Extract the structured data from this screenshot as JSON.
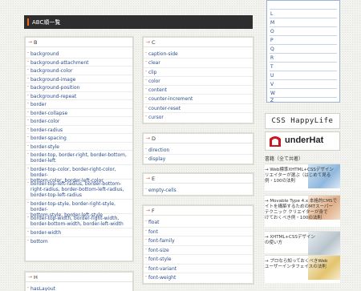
{
  "section_title": "ABC順一覧",
  "panels": {
    "B": {
      "letter": "B",
      "items": [
        "background",
        "background-attachment",
        "background-color",
        "background-image",
        "background-position",
        "background-repeat",
        "border",
        "border-collapse",
        "border-color",
        "border-radius",
        "border-spacing",
        "border-style",
        "border-top, border-right, border-bottom,",
        "border-left",
        "border-top-color, border-right-color, border-",
        "bottom-color, border-left-color",
        "border-top-left-radius, border-bottom-",
        "right-radius, border-bottom-left-radius,",
        "border-top-left-radius",
        "border-top-style, border-right-style, border-",
        "bottom-style, border-left-style",
        "border-top-width, border-right-width,",
        "border-bottom-width, border-left-width",
        "border-width",
        "bottom"
      ]
    },
    "C": {
      "letter": "C",
      "items": [
        "caption-side",
        "clear",
        "clip",
        "color",
        "content",
        "counter-increment",
        "counter-reset",
        "cursor"
      ]
    },
    "D": {
      "letter": "D",
      "items": [
        "direction",
        "display"
      ]
    },
    "E": {
      "letter": "E",
      "items": [
        "empty-cells"
      ]
    },
    "F": {
      "letter": "F",
      "items": [
        "float",
        "font",
        "font-family",
        "font-size",
        "font-style",
        "font-variant",
        "font-weight"
      ]
    },
    "H": {
      "letter": "H",
      "items": [
        "hasLayout"
      ]
    }
  },
  "nav_letters": [
    "L",
    "M",
    "O",
    "P",
    "Q",
    "R",
    "T",
    "U",
    "V",
    "W",
    "Z"
  ],
  "banners": {
    "happylife": "CSS HappyLife",
    "underhat": "underHat"
  },
  "recommend_title": "書籍（全て共著）",
  "recommend_items": [
    {
      "line1": "→ Web標準XHTML+CSSデザイン",
      "line2": "リエイターが選ぶ（はじめて見る",
      "line3": "例・100の法則"
    },
    {
      "line1": "→ Movable Type 4.x 本格的CMSで",
      "line2": "イトを構築するためのMTスーパー",
      "line3": "テクニック クリエイターが身で",
      "line4": "けておくべき例・100の法則"
    },
    {
      "line1": "→ XHTML+CSSデザイン",
      "line2": "の使い方"
    },
    {
      "line1": "→ プロなら知っておくべきWeb",
      "line2": "ユーザーインタフェイスの法則"
    }
  ]
}
